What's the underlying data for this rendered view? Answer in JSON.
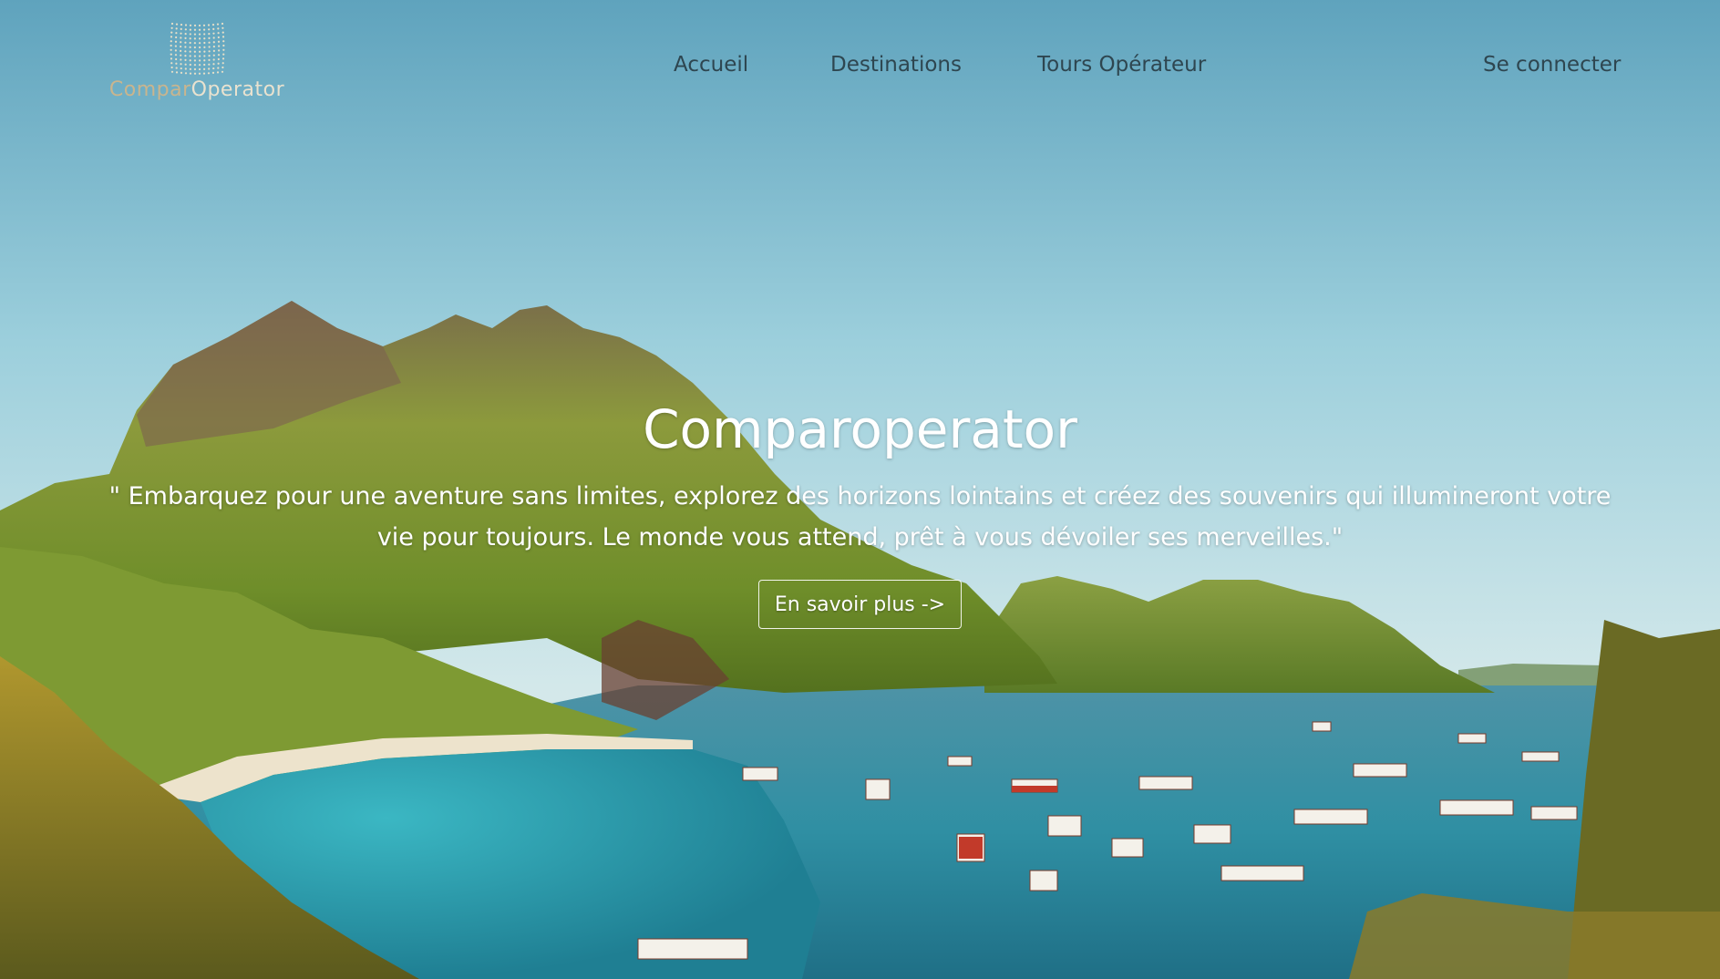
{
  "brand": {
    "logo_part1": "Compar",
    "logo_part2": "Operator",
    "logo_icon": "grid-dots-logo-icon"
  },
  "nav": {
    "items": [
      {
        "label": "Accueil"
      },
      {
        "label": "Destinations"
      },
      {
        "label": "Tours Opérateur"
      }
    ],
    "login_label": "Se connecter"
  },
  "hero": {
    "title": "Comparoperator",
    "quote": "\" Embarquez pour une aventure sans limites, explorez des horizons lointains et créez des souvenirs qui illumineront votre vie pour toujours. Le monde vous attend, prêt à vous dévoiler ses merveilles.\"",
    "cta_label": "En savoir plus ->"
  },
  "colors": {
    "nav_text": "#2e4650",
    "logo_gold": "#c9b58e",
    "hero_text": "#ffffff"
  }
}
